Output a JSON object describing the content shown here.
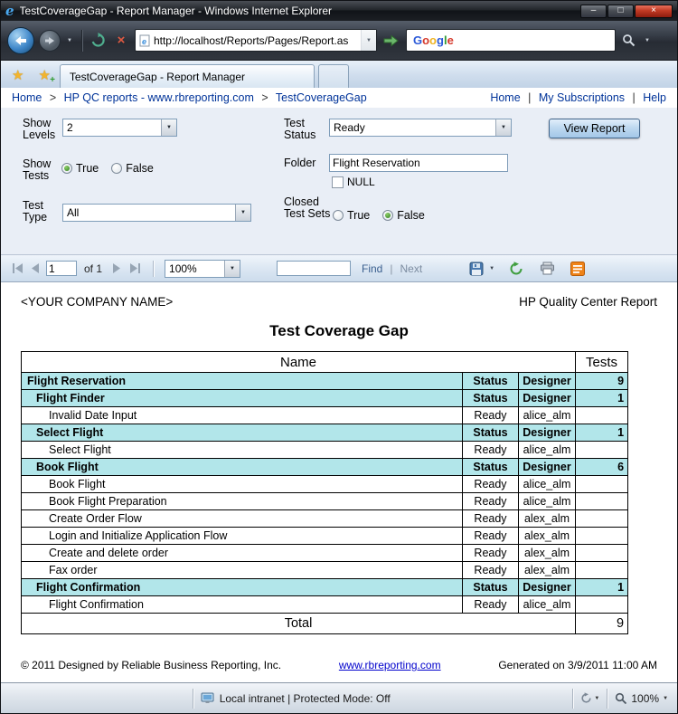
{
  "window": {
    "title": "TestCoverageGap - Report Manager - Windows Internet Explorer",
    "min": "–",
    "max": "□",
    "close": "×"
  },
  "icons": {
    "ie": "e",
    "chevron": "▼",
    "star": "★",
    "plus": "+",
    "stop": "×",
    "pipe": "|",
    "gt": ">"
  },
  "nav": {
    "address": "http://localhost/Reports/Pages/Report.as"
  },
  "search": {
    "letters": [
      {
        "ch": "G",
        "style": "color:#2b59d8"
      },
      {
        "ch": "o",
        "style": "color:#d5382b"
      },
      {
        "ch": "o",
        "style": "color:#efb320"
      },
      {
        "ch": "g",
        "style": "color:#2b59d8"
      },
      {
        "ch": "l",
        "style": "color:#2f9b34"
      },
      {
        "ch": "e",
        "style": "color:#d5382b"
      }
    ]
  },
  "tabs": {
    "active": "TestCoverageGap - Report Manager"
  },
  "breadcrumb": {
    "crumbs": [
      "Home",
      "HP QC reports - www.rbreporting.com",
      "TestCoverageGap"
    ],
    "links": [
      "Home",
      "My Subscriptions",
      "Help"
    ]
  },
  "params": {
    "show_levels_label": "Show Levels",
    "show_levels_value": "2",
    "test_status_label": "Test Status",
    "test_status_value": "Ready",
    "view_report_label": "View Report",
    "show_tests_label": "Show Tests",
    "true_label": "True",
    "false_label": "False",
    "folder_label": "Folder",
    "folder_value": "Flight Reservation",
    "null_label": "NULL",
    "test_type_label": "Test Type",
    "test_type_value": "All",
    "closed_test_sets_label": "Closed Test Sets"
  },
  "toolbar": {
    "page_value": "1",
    "of_label": "of 1",
    "zoom_value": "100%",
    "find_label": "Find",
    "next_label": "Next"
  },
  "report": {
    "company": "<YOUR COMPANY NAME>",
    "header_right": "HP Quality Center Report",
    "title": "Test Coverage Gap",
    "col_name": "Name",
    "col_tests": "Tests",
    "rows": [
      {
        "name": "Flight Reservation",
        "status": "Status",
        "designer": "Designer",
        "tests": "9"
      },
      {
        "name": "Flight Finder",
        "status": "Status",
        "designer": "Designer",
        "tests": "1"
      },
      {
        "name": "Invalid Date Input",
        "status": "Ready",
        "designer": "alice_alm",
        "tests": ""
      },
      {
        "name": "Select Flight",
        "status": "Status",
        "designer": "Designer",
        "tests": "1"
      },
      {
        "name": "Select Flight",
        "status": "Ready",
        "designer": "alice_alm",
        "tests": ""
      },
      {
        "name": "Book Flight",
        "status": "Status",
        "designer": "Designer",
        "tests": "6"
      },
      {
        "name": "Book Flight",
        "status": "Ready",
        "designer": "alice_alm",
        "tests": ""
      },
      {
        "name": "Book Flight Preparation",
        "status": "Ready",
        "designer": "alice_alm",
        "tests": ""
      },
      {
        "name": "Create Order Flow",
        "status": "Ready",
        "designer": "alex_alm",
        "tests": ""
      },
      {
        "name": "Login and Initialize Application Flow",
        "status": "Ready",
        "designer": "alex_alm",
        "tests": ""
      },
      {
        "name": "Create and delete order",
        "status": "Ready",
        "designer": "alex_alm",
        "tests": ""
      },
      {
        "name": "Fax order",
        "status": "Ready",
        "designer": "alex_alm",
        "tests": ""
      },
      {
        "name": "Flight Confirmation",
        "status": "Status",
        "designer": "Designer",
        "tests": "1"
      },
      {
        "name": "Flight Confirmation",
        "status": "Ready",
        "designer": "alice_alm",
        "tests": ""
      }
    ],
    "total_label": "Total",
    "total_value": "9",
    "footer_left": "© 2011 Designed by Reliable Business Reporting, Inc.",
    "footer_link": "www.rbreporting.com",
    "footer_right": "Generated on 3/9/2011 11:00 AM"
  },
  "statusbar": {
    "zone": "Local intranet | Protected Mode: Off",
    "zoom": "100%"
  },
  "colors": {
    "group_row_bg": "#b2e6ea",
    "link": "#003399",
    "footer_link": "#0000cc",
    "params_bg": "#e9eef6",
    "toolbar_bg": "#d6e2f0"
  }
}
